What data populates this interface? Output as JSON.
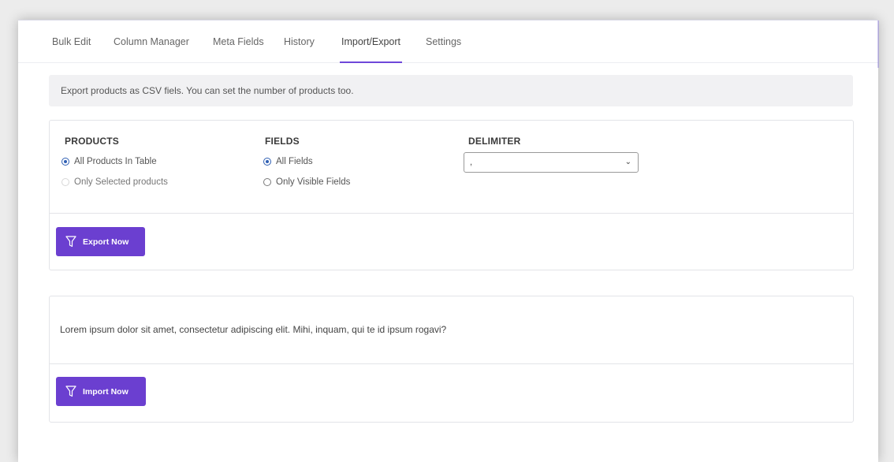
{
  "tabs": [
    {
      "label": "Bulk Edit"
    },
    {
      "label": "Column Manager"
    },
    {
      "label": "Meta Fields"
    },
    {
      "label": "History"
    },
    {
      "label": "Import/Export"
    },
    {
      "label": "Settings"
    }
  ],
  "active_tab": "Import/Export",
  "notice": "Export products as CSV fiels. You can set the number of products too.",
  "export": {
    "products_title": "PRODUCTS",
    "products_options": [
      "All Products In Table",
      "Only Selected products"
    ],
    "products_selected": "All Products In Table",
    "fields_title": "FIELDS",
    "fields_options": [
      "All Fields",
      "Only Visible Fields"
    ],
    "fields_selected": "All Fields",
    "delimiter_title": "DELIMITER",
    "delimiter_value": ",",
    "button_label": "Export Now",
    "button_icon": "filter-icon"
  },
  "import": {
    "text": "Lorem ipsum dolor sit amet, consectetur adipiscing elit. Mihi, inquam, qui te id ipsum rogavi?",
    "button_label": "Import Now",
    "button_icon": "filter-icon"
  },
  "colors": {
    "accent": "#6b3fd0",
    "tab_underline": "#6f47d9",
    "radio_checked": "#2f5fb3"
  }
}
